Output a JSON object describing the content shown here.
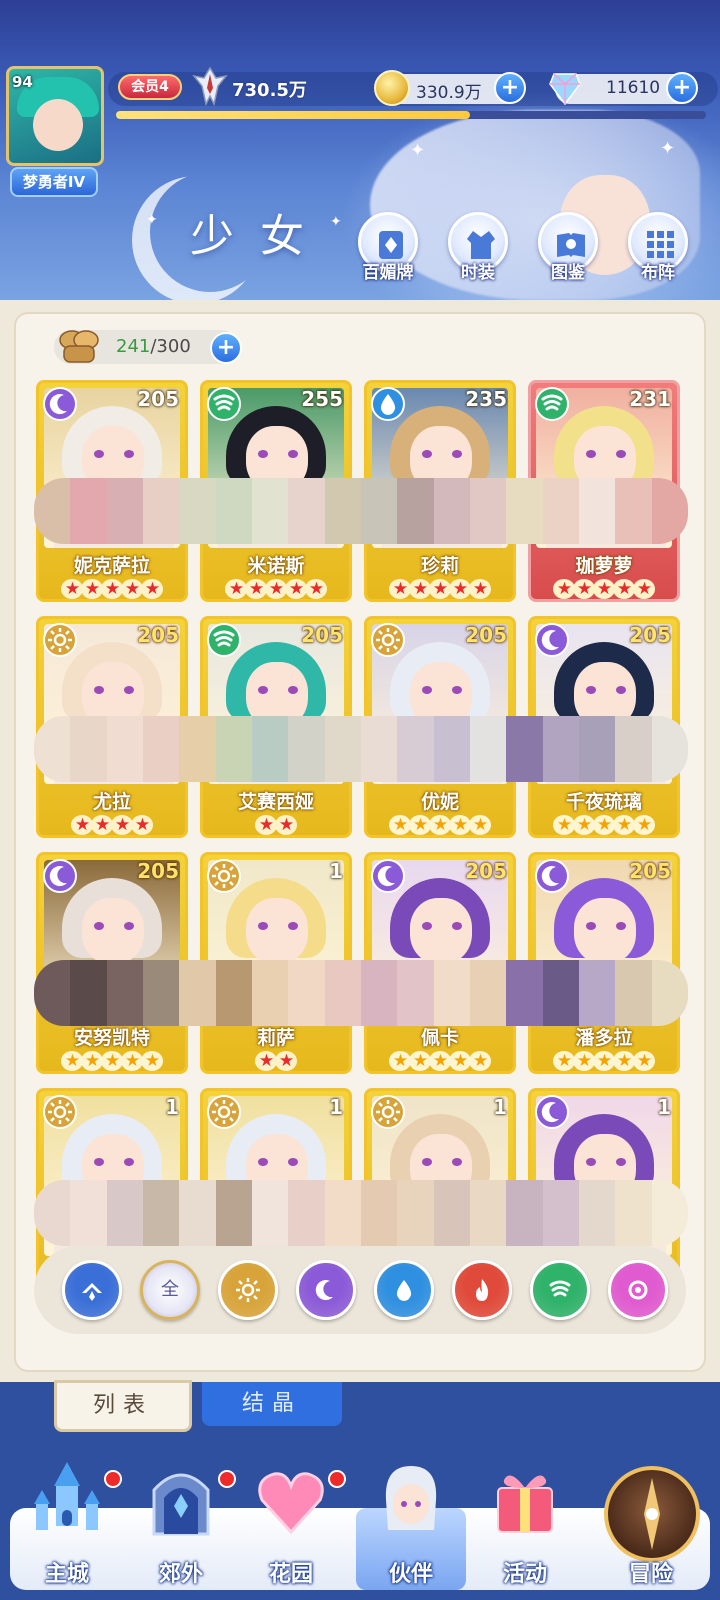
{
  "player": {
    "level": "94",
    "title": "梦勇者IV",
    "vip": "会员4",
    "power": "730.5万",
    "exp_fraction": 0.6
  },
  "resources": {
    "coins": "330.9万",
    "gems": "11610",
    "plus": "+"
  },
  "page": {
    "title": "少女"
  },
  "top_buttons": [
    {
      "label": "百媚牌",
      "icon": "card-deck-icon"
    },
    {
      "label": "时装",
      "icon": "outfit-icon"
    },
    {
      "label": "图鉴",
      "icon": "encyclopedia-icon"
    },
    {
      "label": "布阵",
      "icon": "formation-grid-icon"
    }
  ],
  "capacity": {
    "current": "241",
    "max": "/300"
  },
  "cards": [
    {
      "name": "妮克萨拉",
      "level": "205",
      "element": "moon",
      "stars": 5,
      "star_color": "red"
    },
    {
      "name": "米诺斯",
      "level": "255",
      "element": "wind",
      "stars": 5,
      "star_color": "red"
    },
    {
      "name": "珍莉",
      "level": "235",
      "element": "water",
      "stars": 5,
      "star_color": "red"
    },
    {
      "name": "珈萝萝",
      "level": "231",
      "element": "wind",
      "stars": 5,
      "star_color": "red",
      "frame": "red"
    },
    {
      "name": "尤拉",
      "level": "205",
      "element": "sun",
      "stars": 4,
      "star_color": "red"
    },
    {
      "name": "艾赛西娅",
      "level": "205",
      "element": "wind",
      "stars": 2,
      "star_color": "red"
    },
    {
      "name": "优妮",
      "level": "205",
      "element": "sun",
      "stars": 5,
      "star_color": "gold"
    },
    {
      "name": "千夜琉璃",
      "level": "205",
      "element": "moon",
      "stars": 5,
      "star_color": "gold"
    },
    {
      "name": "安努凯特",
      "level": "205",
      "element": "moon",
      "stars": 5,
      "star_color": "gold"
    },
    {
      "name": "莉萨",
      "level": "1",
      "element": "sun",
      "stars": 2,
      "star_color": "red"
    },
    {
      "name": "佩卡",
      "level": "205",
      "element": "moon",
      "stars": 5,
      "star_color": "gold"
    },
    {
      "name": "潘多拉",
      "level": "205",
      "element": "moon",
      "stars": 5,
      "star_color": "gold"
    },
    {
      "name": "",
      "level": "1",
      "element": "sun",
      "stars": 0,
      "star_color": "gold"
    },
    {
      "name": "",
      "level": "1",
      "element": "sun",
      "stars": 0,
      "star_color": "gold"
    },
    {
      "name": "",
      "level": "1",
      "element": "sun",
      "stars": 0,
      "star_color": "gold"
    },
    {
      "name": "",
      "level": "1",
      "element": "moon",
      "stars": 0,
      "star_color": "gold"
    }
  ],
  "filters": [
    {
      "name": "rank-filter",
      "label": ""
    },
    {
      "name": "all-filter",
      "label": "全"
    },
    {
      "name": "sun-filter",
      "label": ""
    },
    {
      "name": "moon-filter",
      "label": ""
    },
    {
      "name": "water-filter",
      "label": ""
    },
    {
      "name": "fire-filter",
      "label": ""
    },
    {
      "name": "wind-filter",
      "label": ""
    },
    {
      "name": "light-filter",
      "label": ""
    }
  ],
  "tabs": {
    "list": "列表",
    "crystal": "结晶"
  },
  "nav": [
    {
      "label": "主城",
      "icon": "castle-icon",
      "badge": true
    },
    {
      "label": "郊外",
      "icon": "gate-icon",
      "badge": true
    },
    {
      "label": "花园",
      "icon": "heart-garden-icon",
      "badge": true
    },
    {
      "label": "伙伴",
      "icon": "partner-icon",
      "badge": false,
      "active": true
    },
    {
      "label": "活动",
      "icon": "gift-icon",
      "badge": false
    },
    {
      "label": "冒险",
      "icon": "compass-icon",
      "badge": false
    }
  ],
  "colors": {
    "elements": {
      "moon": "#8b5ad8",
      "wind": "#2fb26a",
      "water": "#2f8fe0",
      "sun": "#d8a43a",
      "fire": "#e04a3a",
      "light": "#e05ad0",
      "rank": "#3a6fd8"
    }
  }
}
